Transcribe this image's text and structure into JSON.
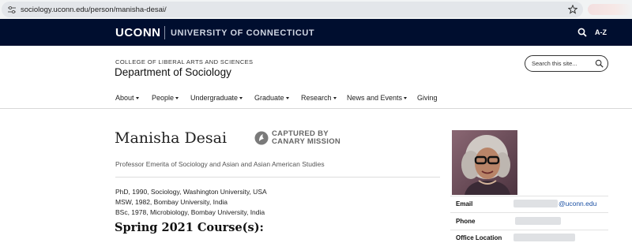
{
  "browser": {
    "url": "sociology.uconn.edu/person/manisha-desai/"
  },
  "uconn_bar": {
    "wordmark": "UCONN",
    "university": "UNIVERSITY OF CONNECTICUT",
    "az_label": "A-Z"
  },
  "header": {
    "college": "COLLEGE OF LIBERAL ARTS AND SCIENCES",
    "department": "Department of Sociology",
    "search_placeholder": "Search this site..."
  },
  "nav": {
    "items": [
      {
        "label": "About",
        "has_menu": true
      },
      {
        "label": "People",
        "has_menu": true
      },
      {
        "label": "Undergraduate",
        "has_menu": true
      },
      {
        "label": "Graduate",
        "has_menu": true
      },
      {
        "label": "Research",
        "has_menu": true
      },
      {
        "label": "News and Events",
        "has_menu": true
      },
      {
        "label": "Giving",
        "has_menu": false
      }
    ]
  },
  "person": {
    "name": "Manisha Desai",
    "title": "Professor Emerita of Sociology and Asian and Asian American Studies",
    "degrees": [
      "PhD, 1990, Sociology, Washington University, USA",
      "MSW, 1982, Bombay University, India",
      "BSc, 1978, Microbiology, Bombay University, India"
    ],
    "courses_heading": "Spring 2021 Course(s):"
  },
  "canary_badge": {
    "line1": "CAPTURED BY",
    "line2": "CANARY MISSION"
  },
  "contact": {
    "email_label": "Email",
    "email_domain": "@uconn.edu",
    "phone_label": "Phone",
    "office_label": "Office Location"
  },
  "colors": {
    "navy": "#000e2f",
    "link": "#1a4fa3",
    "redaction": "#dfe1e4"
  }
}
